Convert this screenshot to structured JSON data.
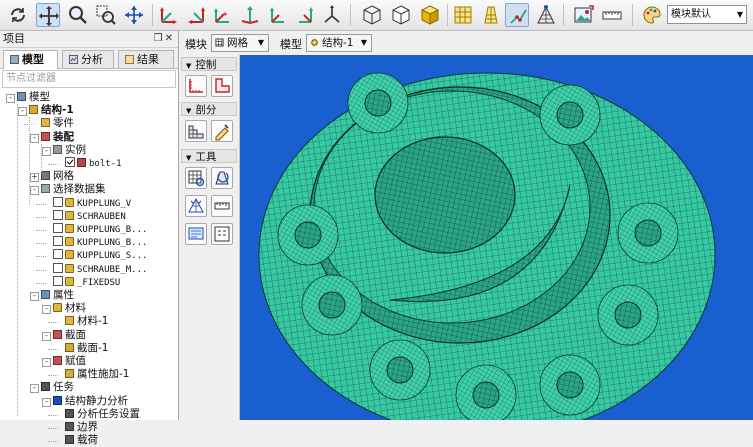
{
  "toolbar": {
    "icons": [
      "rotate-icon",
      "pan-icon",
      "zoom-icon",
      "box-zoom-icon",
      "fit-view-icon",
      "view-front-icon",
      "view-back-icon",
      "view-top-icon",
      "view-bottom-icon",
      "view-left-icon",
      "view-right-icon",
      "view-iso-icon",
      "wireframe-icon",
      "hidden-line-icon",
      "shaded-icon",
      "mesh-toggle-icon",
      "mesh-sweep-icon",
      "edge-select-icon",
      "node-select-icon",
      "image-export-icon",
      "ruler-icon",
      "palette-icon"
    ],
    "color_scheme": "模块默认"
  },
  "panel": {
    "title": "项目",
    "tabs": [
      "模型",
      "分析",
      "结果"
    ],
    "filter_placeholder": "节点过滤器"
  },
  "tree": [
    {
      "label": "模型",
      "bold": false,
      "icon": "model-icon",
      "depth": 0,
      "exp": "-"
    },
    {
      "label": "结构-1",
      "bold": true,
      "icon": "structure-icon",
      "depth": 1,
      "exp": "-"
    },
    {
      "label": "零件",
      "bold": false,
      "icon": "part-icon",
      "depth": 2,
      "exp": ""
    },
    {
      "label": "装配",
      "bold": true,
      "icon": "assembly-icon",
      "depth": 2,
      "exp": "-"
    },
    {
      "label": "实例",
      "bold": false,
      "icon": "instance-icon",
      "depth": 3,
      "exp": "-"
    },
    {
      "label": "bolt-1",
      "bold": false,
      "icon": "bolt-icon",
      "depth": 4,
      "exp": "",
      "check": true,
      "mono": true
    },
    {
      "label": "网格",
      "bold": false,
      "icon": "mesh-icon",
      "depth": 2,
      "exp": "+"
    },
    {
      "label": "选择数据集",
      "bold": false,
      "icon": "dataset-icon",
      "depth": 2,
      "exp": "-"
    },
    {
      "label": "KUPPLUNG_V",
      "bold": false,
      "icon": "set-icon",
      "depth": 3,
      "exp": "",
      "check": false,
      "mono": true
    },
    {
      "label": "SCHRAUBEN",
      "bold": false,
      "icon": "set-icon",
      "depth": 3,
      "exp": "",
      "check": false,
      "mono": true
    },
    {
      "label": "KUPPLUNG_B...",
      "bold": false,
      "icon": "set-icon",
      "depth": 3,
      "exp": "",
      "check": false,
      "mono": true
    },
    {
      "label": "KUPPLUNG_B...",
      "bold": false,
      "icon": "set-icon",
      "depth": 3,
      "exp": "",
      "check": false,
      "mono": true
    },
    {
      "label": "KUPPLUNG_S...",
      "bold": false,
      "icon": "set-icon",
      "depth": 3,
      "exp": "",
      "check": false,
      "mono": true
    },
    {
      "label": "SCHRAUBE_M...",
      "bold": false,
      "icon": "set-icon",
      "depth": 3,
      "exp": "",
      "check": false,
      "mono": true
    },
    {
      "label": "_FIXEDSU",
      "bold": false,
      "icon": "set-icon",
      "depth": 3,
      "exp": "",
      "check": false,
      "mono": true
    },
    {
      "label": "属性",
      "bold": false,
      "icon": "property-icon",
      "depth": 2,
      "exp": "-"
    },
    {
      "label": "材料",
      "bold": false,
      "icon": "material-icon",
      "depth": 3,
      "exp": "-"
    },
    {
      "label": "材料-1",
      "bold": false,
      "icon": "material-item-icon",
      "depth": 4,
      "exp": ""
    },
    {
      "label": "截面",
      "bold": false,
      "icon": "section-icon",
      "depth": 3,
      "exp": "-"
    },
    {
      "label": "截面-1",
      "bold": false,
      "icon": "section-item-icon",
      "depth": 4,
      "exp": ""
    },
    {
      "label": "赋值",
      "bold": false,
      "icon": "assign-icon",
      "depth": 3,
      "exp": "-"
    },
    {
      "label": "属性施加-1",
      "bold": false,
      "icon": "assign-item-icon",
      "depth": 4,
      "exp": ""
    },
    {
      "label": "任务",
      "bold": false,
      "icon": "task-icon",
      "depth": 2,
      "exp": "-"
    },
    {
      "label": "结构静力分析",
      "bold": false,
      "icon": "analysis-icon",
      "depth": 3,
      "exp": "-"
    },
    {
      "label": "分析任务设置",
      "bold": false,
      "icon": "settings-icon",
      "depth": 4,
      "exp": ""
    },
    {
      "label": "边界",
      "bold": false,
      "icon": "boundary-icon",
      "depth": 4,
      "exp": ""
    },
    {
      "label": "载荷",
      "bold": false,
      "icon": "load-icon",
      "depth": 4,
      "exp": ""
    }
  ],
  "context": {
    "module_label": "模块",
    "module_value": "网格",
    "model_label": "模型",
    "model_value": "结构-1"
  },
  "tools": {
    "sections": [
      "控制",
      "剖分",
      "工具"
    ],
    "buttons": [
      "seed-edge-icon",
      "seed-part-icon",
      "mesh-part-icon",
      "mesh-controls-icon",
      "mesh-verify-icon",
      "refresh-mesh-icon",
      "edit-mesh-icon",
      "mesh-ruler-icon",
      "query-icon",
      "mesh-stats-icon"
    ]
  },
  "colors": {
    "mesh_fill": "#36c9a3",
    "mesh_line": "#0c3a30",
    "viewport_bg": "#1a5fd0"
  }
}
